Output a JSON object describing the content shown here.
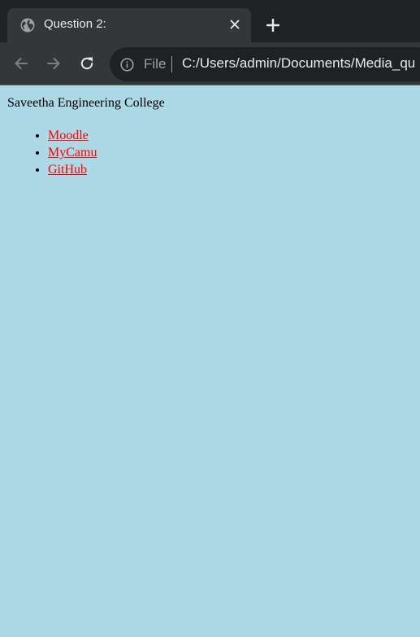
{
  "browser": {
    "tab": {
      "title": "Question 2:"
    },
    "omnibox": {
      "scheme_label": "File",
      "url": "C:/Users/admin/Documents/Media_qu"
    },
    "icons": {
      "favicon": "globe-icon",
      "close": "close-icon",
      "new_tab": "plus-icon",
      "back": "back-arrow-icon",
      "forward": "forward-arrow-icon",
      "reload": "reload-icon",
      "info": "info-icon"
    }
  },
  "page": {
    "heading": "Saveetha Engineering College",
    "links": [
      {
        "label": "Moodle"
      },
      {
        "label": "MyCamu"
      },
      {
        "label": "GitHub"
      }
    ],
    "colors": {
      "background": "#add8e6",
      "link": "#ff0000"
    }
  }
}
